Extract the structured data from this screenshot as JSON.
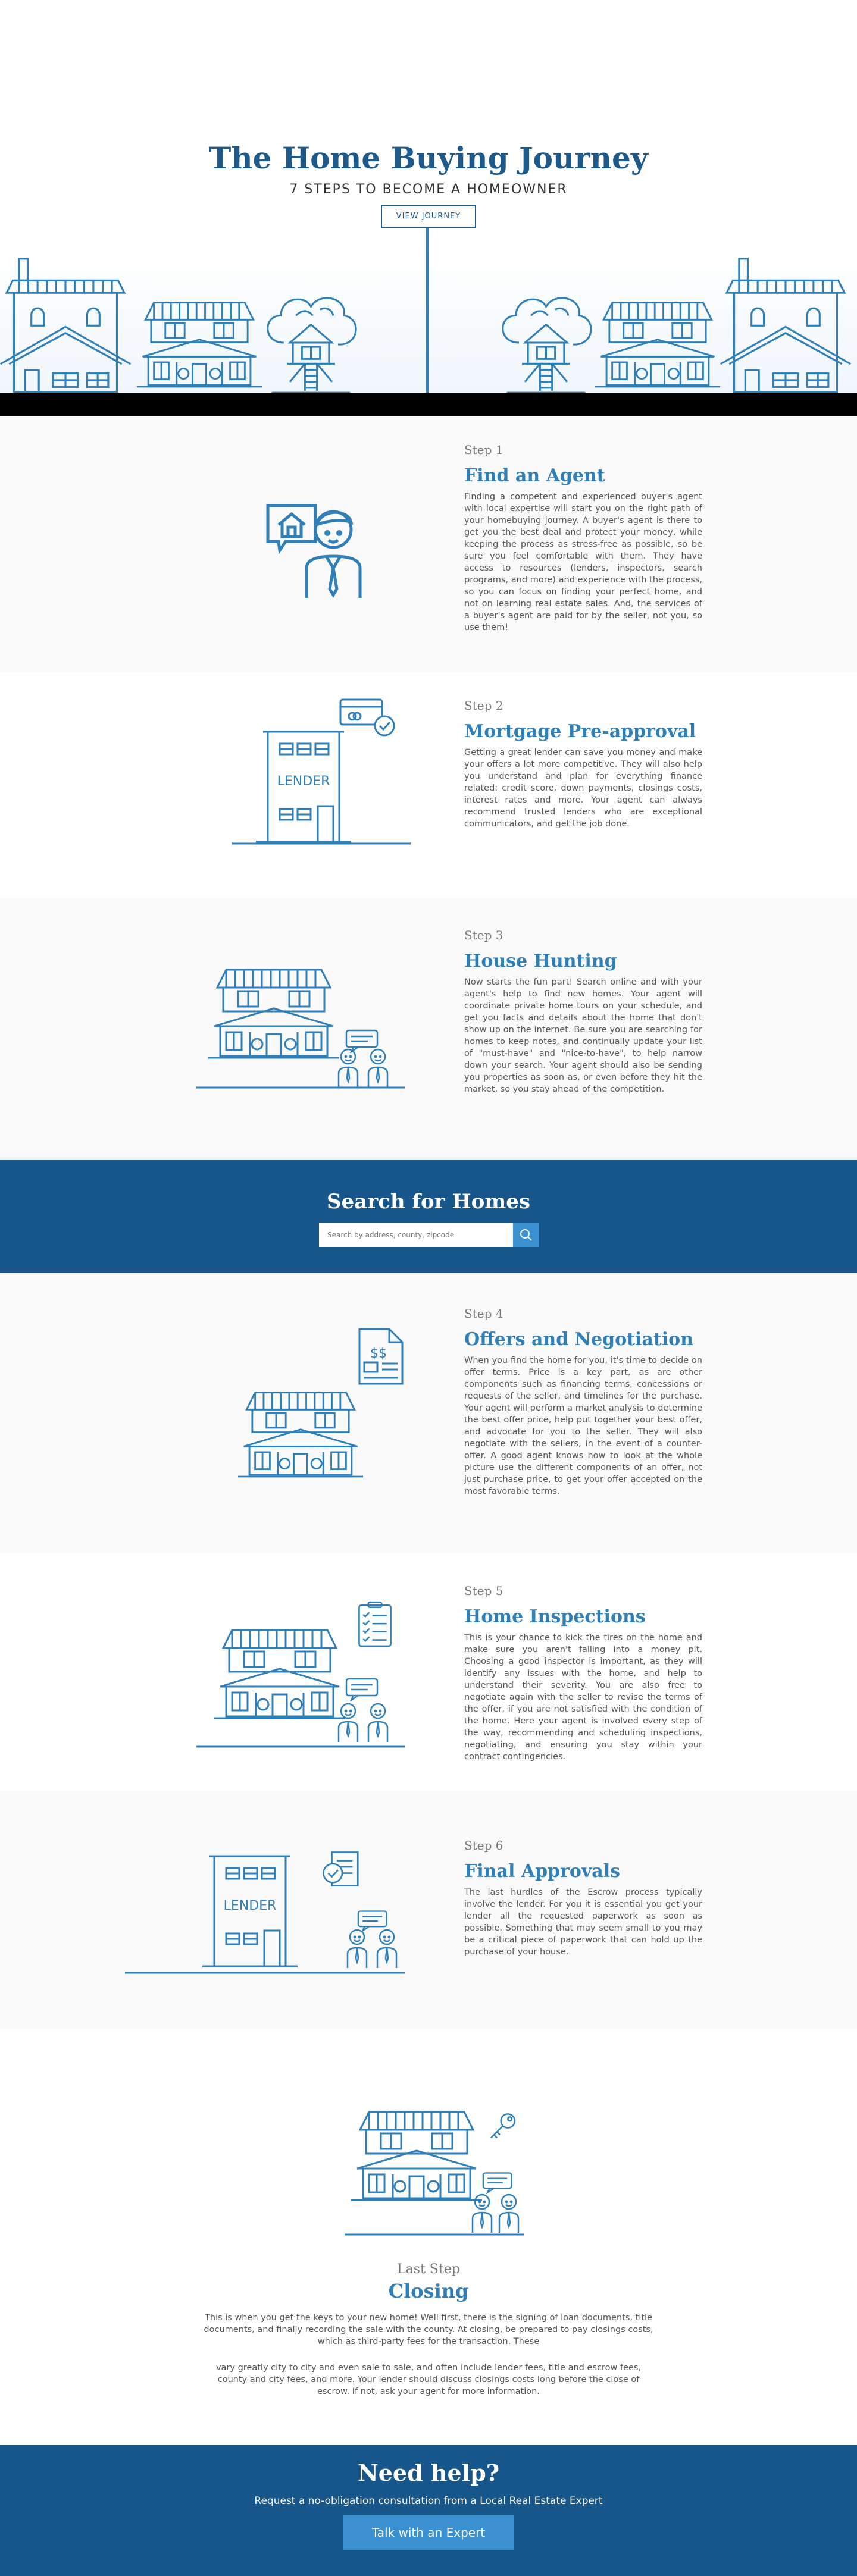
{
  "hero": {
    "title": "The Home Buying Journey",
    "subtitle": "7 STEPS TO BECOME A HOMEOWNER",
    "button_label": "VIEW JOURNEY"
  },
  "steps": [
    {
      "number": "Step 1",
      "title": "Find an Agent",
      "body": "Finding a competent and experienced buyer's agent with local expertise will start you on the right path of your homebuying journey. A buyer's agent is there to get you the best deal and protect your money, while keeping the process as stress-free as possible, so be sure you feel comfortable with them. They have access to resources (lenders, inspectors, search programs, and more) and experience with the process, so you can focus on finding your perfect home, and not on learning real estate sales. And, the services of a buyer's agent are paid for by the seller, not you, so use them!"
    },
    {
      "number": "Step 2",
      "title": "Mortgage Pre-approval",
      "body": "Getting a great lender can save you money and make your offers a lot more competitive. They will also help you understand and plan for everything finance related: credit score, down payments, closings costs, interest rates and more. Your agent can always recommend trusted lenders who are exceptional communicators, and get the job done.",
      "lender_label": "LENDER"
    },
    {
      "number": "Step 3",
      "title": "House Hunting",
      "body": "Now starts the fun part! Search online and with your agent's help to find new homes. Your agent will coordinate private home tours on your schedule, and get you facts and details about the home that don't show up on the internet. Be sure you are searching for homes to keep notes, and continually update your list of \"must-have\" and \"nice-to-have\", to help narrow down your search. Your agent should also be sending you properties as soon as, or even before they hit the market, so you stay ahead of the competition."
    },
    {
      "number": "Step 4",
      "title": "Offers and Negotiation",
      "body": "When you find the home for you, it's time to decide on offer terms. Price is a key part, as are other components such as financing terms, concessions or requests of the seller, and timelines for the purchase. Your agent will perform a market analysis to determine the best offer price, help put together your best offer, and advocate for you to the seller. They will also negotiate with the sellers, in the event of a counter-offer. A good agent knows how to look at the whole picture use the different components of an offer, not just purchase price, to get your offer accepted on the most favorable terms.",
      "doc_label": "$$"
    },
    {
      "number": "Step 5",
      "title": "Home Inspections",
      "body": "This is your chance to kick the tires on the home and make sure you aren't falling into a money pit. Choosing a good inspector is important, as they will identify any issues with the home, and help to understand their severity. You are also free to negotiate again with the seller to revise the terms of the offer, if you are not satisfied with the condition of the home. Here your agent is involved every step of the way, recommending and scheduling inspections, negotiating, and ensuring you stay within your contract contingencies."
    },
    {
      "number": "Step 6",
      "title": "Final Approvals",
      "body": "The last hurdles of the Escrow process typically involve the lender. For you it is essential you get your lender all the requested paperwork as soon as possible. Something that may seem small to you may be a critical piece of paperwork that can hold up the purchase of your house.",
      "lender_label": "LENDER"
    }
  ],
  "search": {
    "title": "Search for Homes",
    "placeholder": "Search by address, county, zipcode"
  },
  "closing": {
    "number": "Last Step",
    "title": "Closing",
    "body1": "This is when you get the keys to your new home! Well first, there is the signing of loan documents, title documents, and finally recording the sale with the county. At closing, be prepared to pay closings costs, which as third-party fees for the transaction. These",
    "body2": "vary greatly city to city and even sale to sale, and often include lender fees, title and escrow fees, county and city fees, and more. Your lender should discuss closings costs long before the close of escrow. If not, ask your agent for more information."
  },
  "help": {
    "title": "Need help?",
    "subtitle": "Request a no-obligation consultation from a Local Real Estate Expert",
    "button_label": "Talk with an Expert"
  },
  "colors": {
    "brand_blue": "#2f7fb8",
    "dark_blue": "#17568a",
    "accent_blue": "#3a90d0"
  }
}
